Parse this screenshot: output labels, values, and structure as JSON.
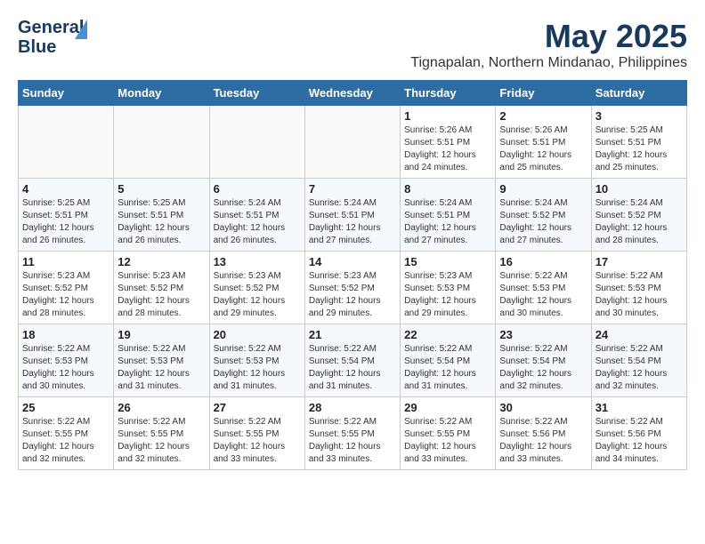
{
  "header": {
    "logo_line1": "General",
    "logo_line2": "Blue",
    "month_title": "May 2025",
    "location": "Tignapalan, Northern Mindanao, Philippines"
  },
  "weekdays": [
    "Sunday",
    "Monday",
    "Tuesday",
    "Wednesday",
    "Thursday",
    "Friday",
    "Saturday"
  ],
  "weeks": [
    [
      {
        "day": "",
        "sunrise": "",
        "sunset": "",
        "daylight": ""
      },
      {
        "day": "",
        "sunrise": "",
        "sunset": "",
        "daylight": ""
      },
      {
        "day": "",
        "sunrise": "",
        "sunset": "",
        "daylight": ""
      },
      {
        "day": "",
        "sunrise": "",
        "sunset": "",
        "daylight": ""
      },
      {
        "day": "1",
        "sunrise": "Sunrise: 5:26 AM",
        "sunset": "Sunset: 5:51 PM",
        "daylight": "Daylight: 12 hours and 24 minutes."
      },
      {
        "day": "2",
        "sunrise": "Sunrise: 5:26 AM",
        "sunset": "Sunset: 5:51 PM",
        "daylight": "Daylight: 12 hours and 25 minutes."
      },
      {
        "day": "3",
        "sunrise": "Sunrise: 5:25 AM",
        "sunset": "Sunset: 5:51 PM",
        "daylight": "Daylight: 12 hours and 25 minutes."
      }
    ],
    [
      {
        "day": "4",
        "sunrise": "Sunrise: 5:25 AM",
        "sunset": "Sunset: 5:51 PM",
        "daylight": "Daylight: 12 hours and 26 minutes."
      },
      {
        "day": "5",
        "sunrise": "Sunrise: 5:25 AM",
        "sunset": "Sunset: 5:51 PM",
        "daylight": "Daylight: 12 hours and 26 minutes."
      },
      {
        "day": "6",
        "sunrise": "Sunrise: 5:24 AM",
        "sunset": "Sunset: 5:51 PM",
        "daylight": "Daylight: 12 hours and 26 minutes."
      },
      {
        "day": "7",
        "sunrise": "Sunrise: 5:24 AM",
        "sunset": "Sunset: 5:51 PM",
        "daylight": "Daylight: 12 hours and 27 minutes."
      },
      {
        "day": "8",
        "sunrise": "Sunrise: 5:24 AM",
        "sunset": "Sunset: 5:51 PM",
        "daylight": "Daylight: 12 hours and 27 minutes."
      },
      {
        "day": "9",
        "sunrise": "Sunrise: 5:24 AM",
        "sunset": "Sunset: 5:52 PM",
        "daylight": "Daylight: 12 hours and 27 minutes."
      },
      {
        "day": "10",
        "sunrise": "Sunrise: 5:24 AM",
        "sunset": "Sunset: 5:52 PM",
        "daylight": "Daylight: 12 hours and 28 minutes."
      }
    ],
    [
      {
        "day": "11",
        "sunrise": "Sunrise: 5:23 AM",
        "sunset": "Sunset: 5:52 PM",
        "daylight": "Daylight: 12 hours and 28 minutes."
      },
      {
        "day": "12",
        "sunrise": "Sunrise: 5:23 AM",
        "sunset": "Sunset: 5:52 PM",
        "daylight": "Daylight: 12 hours and 28 minutes."
      },
      {
        "day": "13",
        "sunrise": "Sunrise: 5:23 AM",
        "sunset": "Sunset: 5:52 PM",
        "daylight": "Daylight: 12 hours and 29 minutes."
      },
      {
        "day": "14",
        "sunrise": "Sunrise: 5:23 AM",
        "sunset": "Sunset: 5:52 PM",
        "daylight": "Daylight: 12 hours and 29 minutes."
      },
      {
        "day": "15",
        "sunrise": "Sunrise: 5:23 AM",
        "sunset": "Sunset: 5:53 PM",
        "daylight": "Daylight: 12 hours and 29 minutes."
      },
      {
        "day": "16",
        "sunrise": "Sunrise: 5:22 AM",
        "sunset": "Sunset: 5:53 PM",
        "daylight": "Daylight: 12 hours and 30 minutes."
      },
      {
        "day": "17",
        "sunrise": "Sunrise: 5:22 AM",
        "sunset": "Sunset: 5:53 PM",
        "daylight": "Daylight: 12 hours and 30 minutes."
      }
    ],
    [
      {
        "day": "18",
        "sunrise": "Sunrise: 5:22 AM",
        "sunset": "Sunset: 5:53 PM",
        "daylight": "Daylight: 12 hours and 30 minutes."
      },
      {
        "day": "19",
        "sunrise": "Sunrise: 5:22 AM",
        "sunset": "Sunset: 5:53 PM",
        "daylight": "Daylight: 12 hours and 31 minutes."
      },
      {
        "day": "20",
        "sunrise": "Sunrise: 5:22 AM",
        "sunset": "Sunset: 5:53 PM",
        "daylight": "Daylight: 12 hours and 31 minutes."
      },
      {
        "day": "21",
        "sunrise": "Sunrise: 5:22 AM",
        "sunset": "Sunset: 5:54 PM",
        "daylight": "Daylight: 12 hours and 31 minutes."
      },
      {
        "day": "22",
        "sunrise": "Sunrise: 5:22 AM",
        "sunset": "Sunset: 5:54 PM",
        "daylight": "Daylight: 12 hours and 31 minutes."
      },
      {
        "day": "23",
        "sunrise": "Sunrise: 5:22 AM",
        "sunset": "Sunset: 5:54 PM",
        "daylight": "Daylight: 12 hours and 32 minutes."
      },
      {
        "day": "24",
        "sunrise": "Sunrise: 5:22 AM",
        "sunset": "Sunset: 5:54 PM",
        "daylight": "Daylight: 12 hours and 32 minutes."
      }
    ],
    [
      {
        "day": "25",
        "sunrise": "Sunrise: 5:22 AM",
        "sunset": "Sunset: 5:55 PM",
        "daylight": "Daylight: 12 hours and 32 minutes."
      },
      {
        "day": "26",
        "sunrise": "Sunrise: 5:22 AM",
        "sunset": "Sunset: 5:55 PM",
        "daylight": "Daylight: 12 hours and 32 minutes."
      },
      {
        "day": "27",
        "sunrise": "Sunrise: 5:22 AM",
        "sunset": "Sunset: 5:55 PM",
        "daylight": "Daylight: 12 hours and 33 minutes."
      },
      {
        "day": "28",
        "sunrise": "Sunrise: 5:22 AM",
        "sunset": "Sunset: 5:55 PM",
        "daylight": "Daylight: 12 hours and 33 minutes."
      },
      {
        "day": "29",
        "sunrise": "Sunrise: 5:22 AM",
        "sunset": "Sunset: 5:55 PM",
        "daylight": "Daylight: 12 hours and 33 minutes."
      },
      {
        "day": "30",
        "sunrise": "Sunrise: 5:22 AM",
        "sunset": "Sunset: 5:56 PM",
        "daylight": "Daylight: 12 hours and 33 minutes."
      },
      {
        "day": "31",
        "sunrise": "Sunrise: 5:22 AM",
        "sunset": "Sunset: 5:56 PM",
        "daylight": "Daylight: 12 hours and 34 minutes."
      }
    ]
  ]
}
